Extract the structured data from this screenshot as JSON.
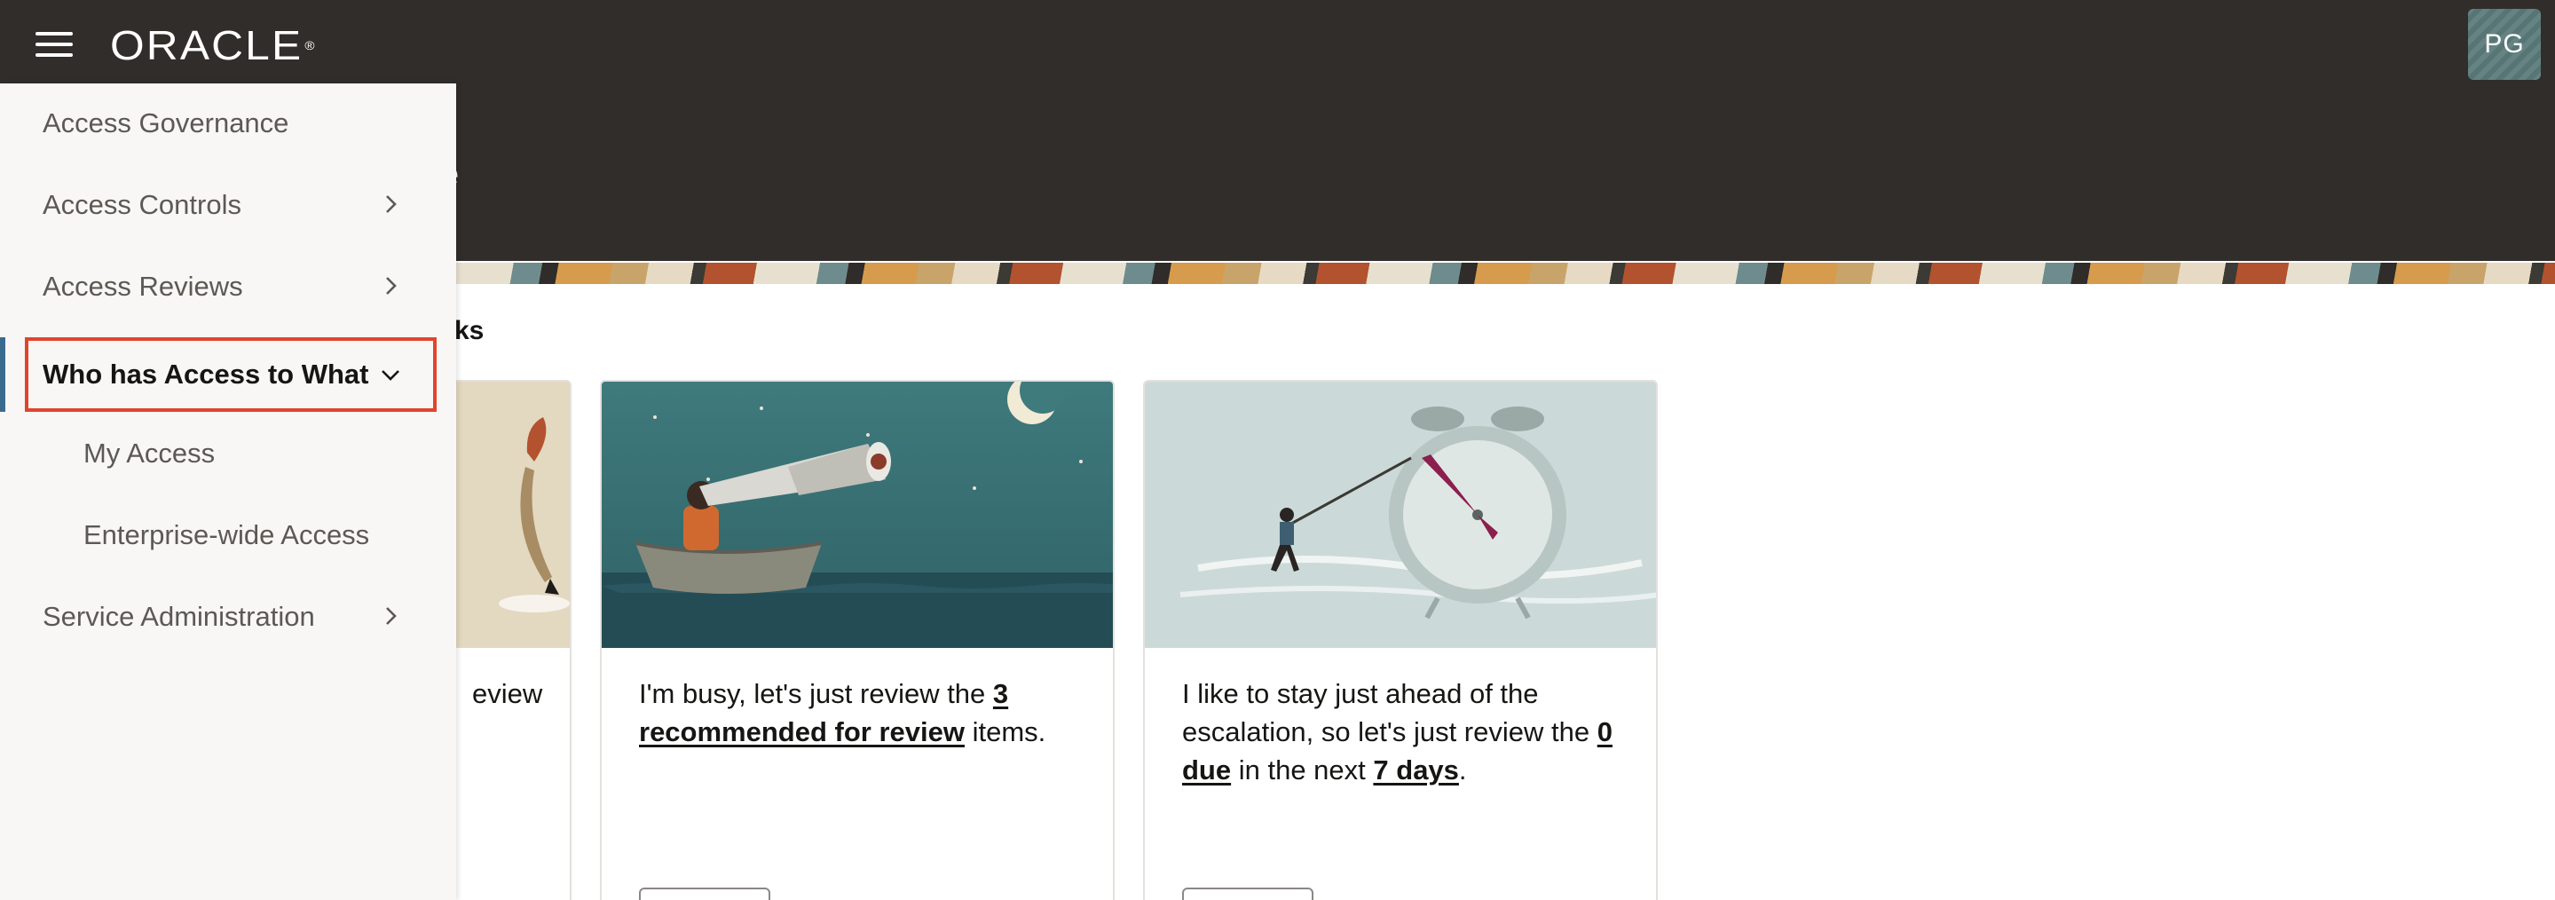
{
  "header": {
    "logo_text": "ORACLE",
    "logo_mark": "®",
    "avatar_initials": "PG",
    "colors": {
      "bar": "#312d2a",
      "avatar": "#5c7b7b"
    }
  },
  "hero": {
    "partial_title": "e",
    "section_title_partial": "ks"
  },
  "nav": {
    "items": [
      {
        "label": "Access Governance",
        "has_chevron": false
      },
      {
        "label": "Access Controls",
        "has_chevron": true,
        "chevron": "chevron-right-icon"
      },
      {
        "label": "Access Reviews",
        "has_chevron": true,
        "chevron": "chevron-right-icon"
      },
      {
        "label": "Who has Access to What",
        "has_chevron": true,
        "chevron": "chevron-down-icon",
        "selected": true
      },
      {
        "label": "My Access",
        "sub": true
      },
      {
        "label": "Enterprise-wide Access",
        "sub": true
      },
      {
        "label": "Service Administration",
        "has_chevron": true,
        "chevron": "chevron-right-icon"
      }
    ],
    "selection_color": "#e0452d"
  },
  "cards": [
    {
      "text_partial": "eview"
    },
    {
      "text_before": "I'm busy, let's just review the ",
      "link": "3 recommended for review",
      "text_after": " items."
    },
    {
      "text_before": "I like to stay just ahead of the escalation, so let's just review the ",
      "link1": "0 due",
      "text_mid": " in the next ",
      "link2": "7 days",
      "text_after": "."
    }
  ]
}
